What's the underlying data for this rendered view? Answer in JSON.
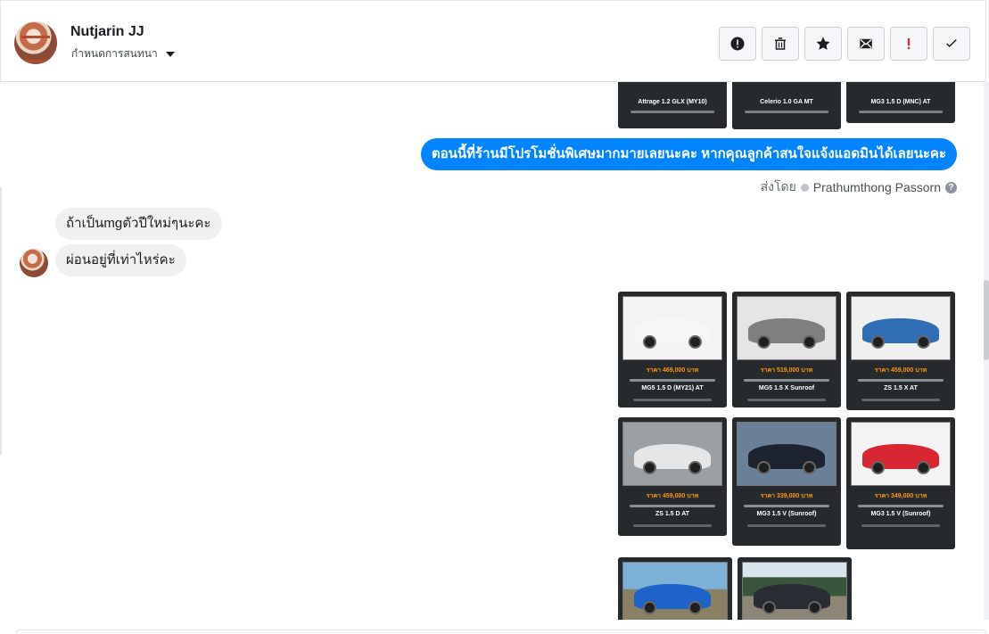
{
  "header": {
    "contact_name": "Nutjarin JJ",
    "status": "กำหนดการสนทนา",
    "actions": [
      "alert",
      "delete",
      "star",
      "mail",
      "!",
      "check"
    ]
  },
  "messages": {
    "outgoing_1": "ตอนนี้ที่ร้านมีโปรโมชั่นพิเศษมากมายเลยนะคะ หากคุณลูกค้าสนใจแจ้งแอดมินได้เลยนะคะ",
    "sent_by_label": "ส่งโดย",
    "sent_by_name": "Prathumthong Passorn",
    "incoming_1": "ถ้าเป็นmgตัวปีใหม่ๆนะคะ",
    "incoming_2": "ผ่อนอยู่ที่เท่าไหร่คะ"
  },
  "top_cards": [
    {
      "model": "Attrage 1.2 GLX (MY10)"
    },
    {
      "model": "Celerio 1.0 GA MT"
    },
    {
      "model": "MG3 1.5 D (MNC) AT"
    }
  ],
  "cards": [
    {
      "price": "ราคา 469,000 บาท",
      "model": "MG5 1.5 D (MY21) AT",
      "color": "#f6f6f6"
    },
    {
      "price": "ราคา 519,000 บาท",
      "model": "MG5 1.5 X Sunroof",
      "color": "#7f7f7f"
    },
    {
      "price": "ราคา 459,000 บาท",
      "model": "ZS 1.5 X AT",
      "color": "#2f6db5"
    },
    {
      "price": "ราคา 459,000 บาท",
      "model": "ZS 1.5 D AT",
      "color": "#e6e6e6"
    },
    {
      "price": "ราคา 339,000 บาท",
      "model": "MG3 1.5 V (Sunroof)",
      "color": "#1d2430"
    },
    {
      "price": "ราคา 349,000 บาท",
      "model": "MG3 1.5 V (Sunroof)",
      "color": "#d82632"
    }
  ]
}
